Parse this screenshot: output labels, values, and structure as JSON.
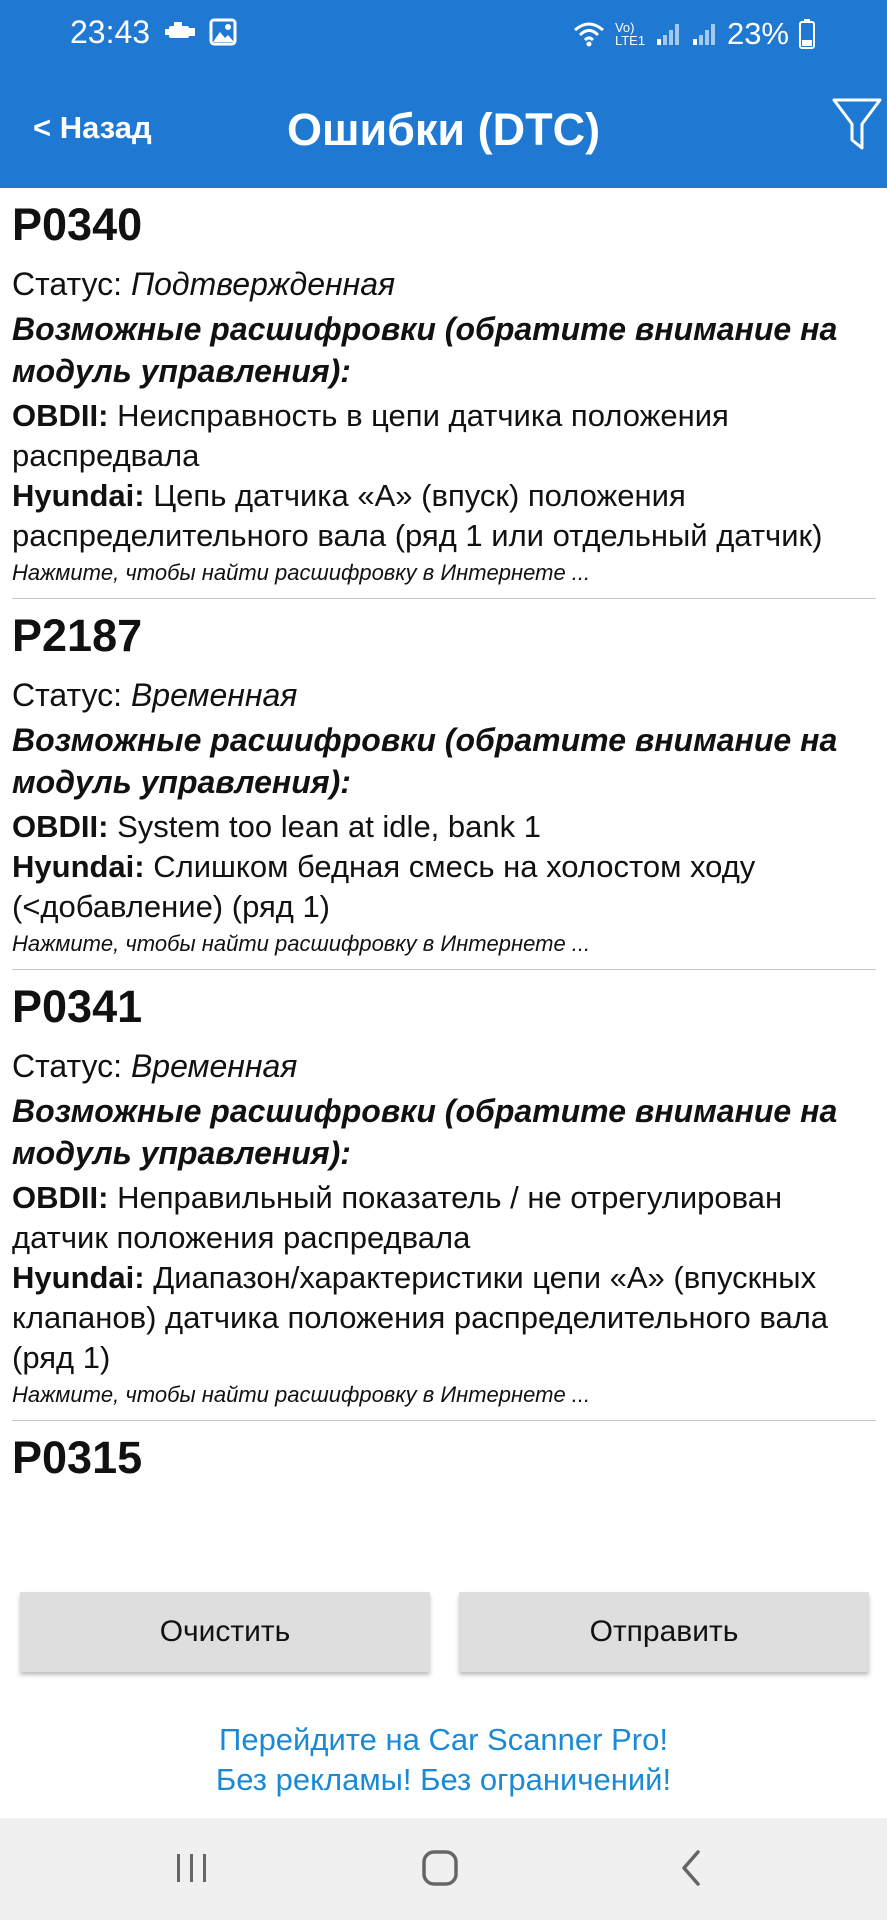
{
  "statusbar": {
    "time": "23:43",
    "battery": "23%",
    "lte": "Vo) LTE1"
  },
  "appbar": {
    "back_label": "< Назад",
    "title": "Ошибки (DTC)",
    "filter_icon": "filter-icon"
  },
  "colors": {
    "appbar_bg": "#1f78d1",
    "button_bg": "#dedede",
    "promo_text": "#1a8ad6"
  },
  "dtcs": [
    {
      "code": "P0340",
      "status_label": "Статус:",
      "status_value": "Подтвержденная",
      "possible": "Возможные расшифровки (обратите внимание на модуль управления):",
      "obd_label": "OBDII:",
      "obd_text": "Неисправность в цепи датчика положения распредвала",
      "mfr_label": "Hyundai:",
      "mfr_text": "Цепь датчика «A» (впуск) положения распределительного вала (ряд 1 или отдельный датчик)",
      "hint": "Нажмите, чтобы найти расшифровку в Интернете ..."
    },
    {
      "code": "P2187",
      "status_label": "Статус:",
      "status_value": "Временная",
      "possible": "Возможные расшифровки (обратите внимание на модуль управления):",
      "obd_label": "OBDII:",
      "obd_text": "System too lean at idle, bank 1",
      "mfr_label": "Hyundai:",
      "mfr_text": "Слишком бедная смесь на холостом ходу (<добавление) (ряд 1)",
      "hint": "Нажмите, чтобы найти расшифровку в Интернете ..."
    },
    {
      "code": "P0341",
      "status_label": "Статус:",
      "status_value": "Временная",
      "possible": "Возможные расшифровки (обратите внимание на модуль управления):",
      "obd_label": "OBDII:",
      "obd_text": "Неправильный показатель / не отрегулирован датчик положения распредвала",
      "mfr_label": "Hyundai:",
      "mfr_text": "Диапазон/характеристики цепи «A» (впускных клапанов) датчика положения распределительного вала (ряд 1)",
      "hint": "Нажмите, чтобы найти расшифровку в Интернете ..."
    },
    {
      "code": "P0315"
    }
  ],
  "buttons": {
    "clear": "Очистить",
    "send": "Отправить"
  },
  "promo": {
    "line1": "Перейдите на Car Scanner Pro!",
    "line2": "Без рекламы! Без ограничений!"
  }
}
